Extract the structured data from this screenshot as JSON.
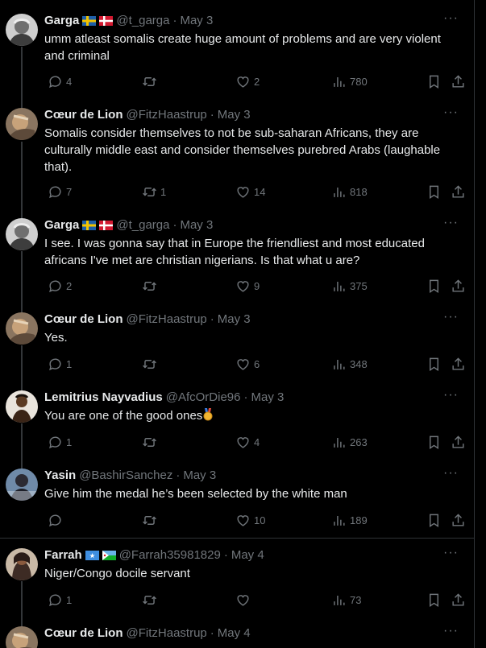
{
  "tweets": [
    {
      "name": "Garga",
      "handle": "@t_garga",
      "date": "May 3",
      "flags": [
        "se",
        "dk"
      ],
      "text": "umm atleast somalis create huge amount of problems and are very violent and criminal",
      "replies": "4",
      "retweets": "",
      "likes": "2",
      "views": "780",
      "avatar": "garga"
    },
    {
      "name": "Cœur de Lion",
      "handle": "@FitzHaastrup",
      "date": "May 3",
      "flags": [],
      "text": "Somalis consider themselves to not be sub-saharan Africans, they are culturally middle east and consider themselves purebred Arabs (laughable that).",
      "replies": "7",
      "retweets": "1",
      "likes": "14",
      "views": "818",
      "avatar": "coeur"
    },
    {
      "name": "Garga",
      "handle": "@t_garga",
      "date": "May 3",
      "flags": [
        "se",
        "dk"
      ],
      "text": "I see. I was gonna say that in Europe the friendliest and most educated africans I've met are christian nigerians. Is that what u are?",
      "replies": "2",
      "retweets": "",
      "likes": "9",
      "views": "375",
      "avatar": "garga"
    },
    {
      "name": "Cœur de Lion",
      "handle": "@FitzHaastrup",
      "date": "May 3",
      "flags": [],
      "text": "Yes.",
      "replies": "1",
      "retweets": "",
      "likes": "6",
      "views": "348",
      "avatar": "coeur"
    },
    {
      "name": "Lemitrius Nayvadius",
      "handle": "@AfcOrDie96",
      "date": "May 3",
      "flags": [],
      "text": "You are one of the good ones",
      "medal": true,
      "replies": "1",
      "retweets": "",
      "likes": "4",
      "views": "263",
      "avatar": "lemi"
    },
    {
      "name": "Yasin",
      "handle": "@BashirSanchez",
      "date": "May 3",
      "flags": [],
      "text": "Give him the medal he’s been selected by the white man",
      "replies": "",
      "retweets": "",
      "likes": "10",
      "views": "189",
      "avatar": "yasin"
    },
    {
      "name": "Farrah",
      "handle": "@Farrah35981829",
      "date": "May 4",
      "flags": [
        "so",
        "dj"
      ],
      "text": "Niger/Congo docile servant",
      "replies": "1",
      "retweets": "",
      "likes": "",
      "views": "73",
      "avatar": "farrah"
    },
    {
      "name": "Cœur de Lion",
      "handle": "@FitzHaastrup",
      "date": "May 4",
      "flags": [],
      "text": "",
      "replies": "",
      "retweets": "",
      "likes": "",
      "views": "",
      "avatar": "coeur"
    }
  ],
  "ui": {
    "more": "···",
    "separator": "·"
  },
  "colors": {
    "background": "#000000",
    "text": "#e7e9ea",
    "muted": "#71767b",
    "border": "#2f3336"
  }
}
